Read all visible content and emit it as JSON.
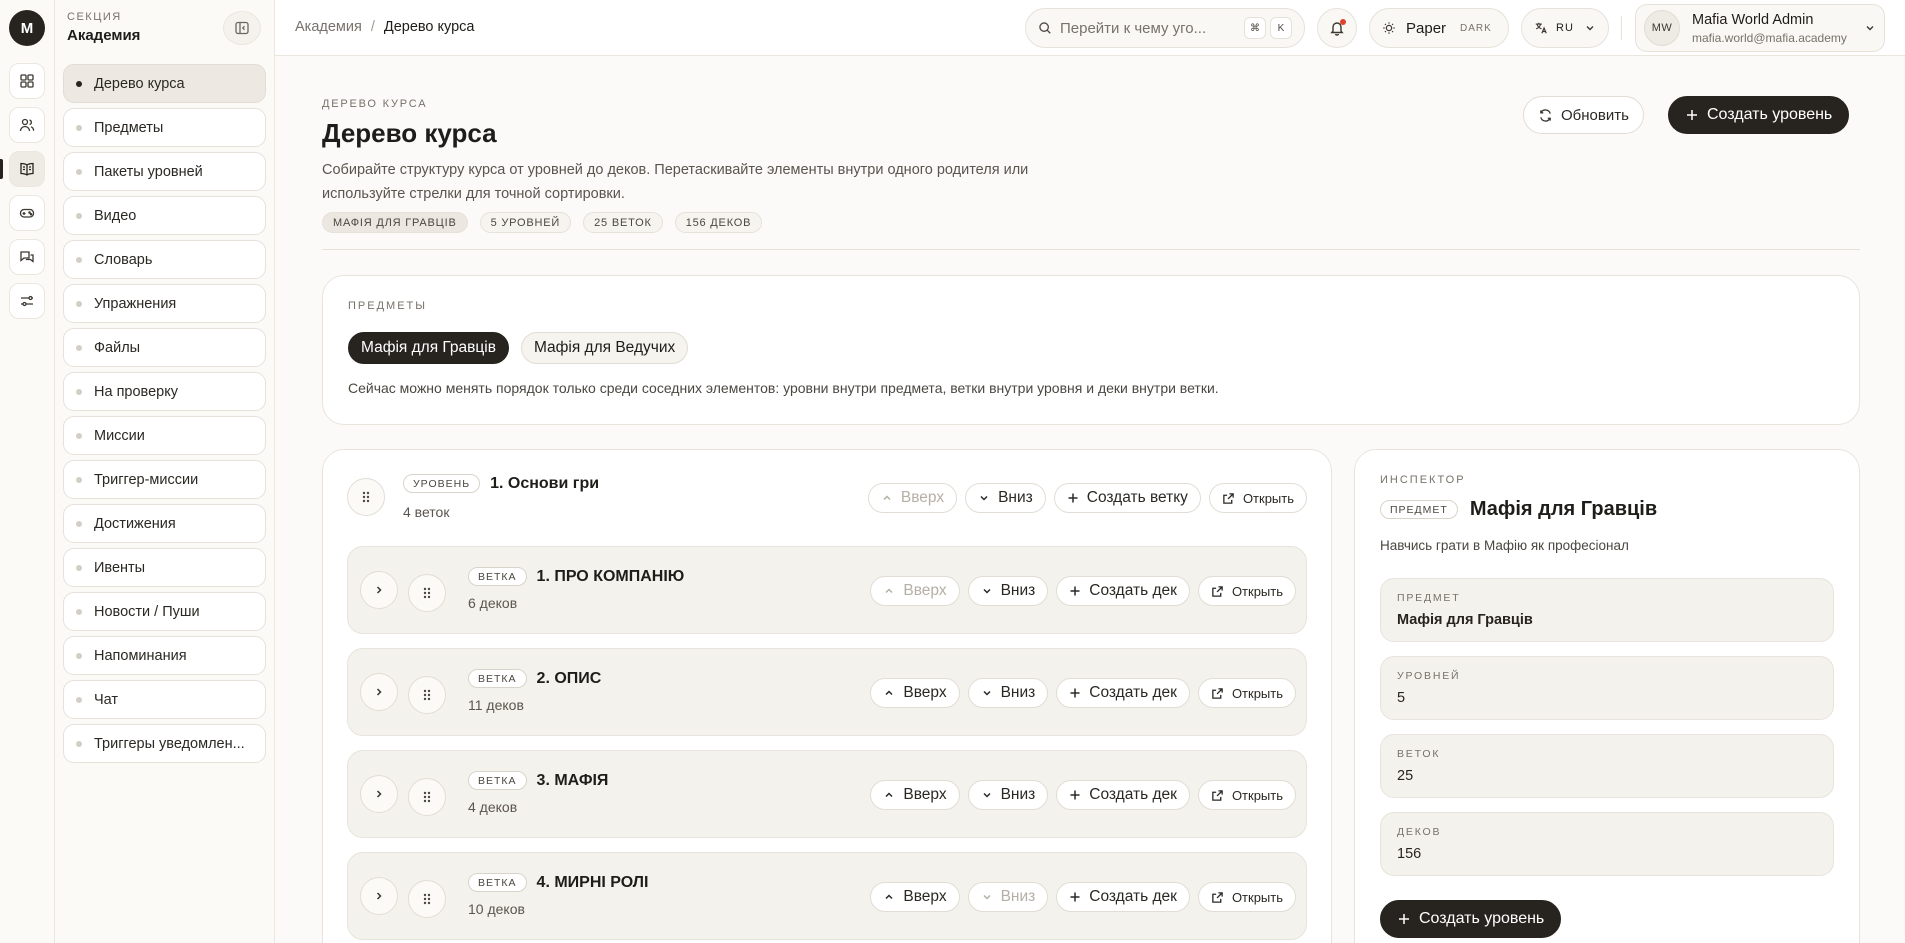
{
  "rail": {
    "logo": "M",
    "icons": [
      "grid-icon",
      "users-icon",
      "book-icon",
      "gamepad-icon",
      "chat-icon",
      "sliders-icon"
    ]
  },
  "sidebar": {
    "kicker": "СЕКЦИЯ",
    "title": "Академия",
    "items": [
      {
        "label": "Дерево курса",
        "active": true
      },
      {
        "label": "Предметы"
      },
      {
        "label": "Пакеты уровней"
      },
      {
        "label": "Видео"
      },
      {
        "label": "Словарь"
      },
      {
        "label": "Упражнения"
      },
      {
        "label": "Файлы"
      },
      {
        "label": "На проверку"
      },
      {
        "label": "Миссии"
      },
      {
        "label": "Триггер-миссии"
      },
      {
        "label": "Достижения"
      },
      {
        "label": "Ивенты"
      },
      {
        "label": "Новости / Пуши"
      },
      {
        "label": "Напоминания"
      },
      {
        "label": "Чат"
      },
      {
        "label": "Триггеры уведомлен..."
      }
    ]
  },
  "topbar": {
    "breadcrumb": {
      "root": "Академия",
      "separator": "/",
      "current": "Дерево курса"
    },
    "search": {
      "placeholder": "Перейти к чему уго...",
      "kbd1": "⌘",
      "kbd2": "K"
    },
    "theme": {
      "label": "Paper",
      "alt": "DARK"
    },
    "lang": "RU",
    "user": {
      "initials": "MW",
      "name": "Mafia World Admin",
      "email": "mafia.world@mafia.academy"
    }
  },
  "header": {
    "kicker": "ДЕРЕВО КУРСА",
    "title": "Дерево курса",
    "description": "Собирайте структуру курса от уровней до деков. Перетаскивайте элементы внутри одного родителя или используйте стрелки для точной сортировки.",
    "chips": [
      "МАФІЯ ДЛЯ ГРАВЦІВ",
      "5 УРОВНЕЙ",
      "25 ВЕТОК",
      "156 ДЕКОВ"
    ],
    "refresh_label": "Обновить",
    "create_level_label": "Создать уровень"
  },
  "subjects": {
    "label": "ПРЕДМЕТЫ",
    "tabs": [
      {
        "label": "Мафія для Гравців",
        "active": true
      },
      {
        "label": "Мафія для Ведучих"
      }
    ],
    "note": "Сейчас можно менять порядок только среди соседних элементов: уровни внутри предмета, ветки внутри уровня и деки внутри ветки."
  },
  "tree": {
    "level": {
      "tag": "УРОВЕНЬ",
      "title": "1. Основи гри",
      "sub": "4 веток",
      "up": "Вверх",
      "down": "Вниз",
      "create": "Создать ветку",
      "open": "Открыть"
    },
    "branches": [
      {
        "tag": "ВЕТКА",
        "title": "1. ПРО КОМПАНІЮ",
        "sub": "6 деков",
        "up": "Вверх",
        "down": "Вниз",
        "create": "Создать дек",
        "open": "Открыть",
        "up_disabled": true,
        "down_disabled": false
      },
      {
        "tag": "ВЕТКА",
        "title": "2. ОПИС",
        "sub": "11 деков",
        "up": "Вверх",
        "down": "Вниз",
        "create": "Создать дек",
        "open": "Открыть",
        "up_disabled": false,
        "down_disabled": false
      },
      {
        "tag": "ВЕТКА",
        "title": "3. МАФІЯ",
        "sub": "4 деков",
        "up": "Вверх",
        "down": "Вниз",
        "create": "Создать дек",
        "open": "Открыть",
        "up_disabled": false,
        "down_disabled": false
      },
      {
        "tag": "ВЕТКА",
        "title": "4. МИРНІ РОЛІ",
        "sub": "10 деков",
        "up": "Вверх",
        "down": "Вниз",
        "create": "Создать дек",
        "open": "Открыть",
        "up_disabled": false,
        "down_disabled": true
      }
    ]
  },
  "inspector": {
    "kicker": "ИНСПЕКТОР",
    "tag": "ПРЕДМЕТ",
    "title": "Мафія для Гравців",
    "description": "Навчись грати в Мафію як професіонал",
    "fields": [
      {
        "label": "ПРЕДМЕТ",
        "value": "Мафія для Гравців"
      },
      {
        "label": "УРОВНЕЙ",
        "value": "5"
      },
      {
        "label": "ВЕТОК",
        "value": "25"
      },
      {
        "label": "ДЕКОВ",
        "value": "156"
      }
    ],
    "create_level_label": "Создать уровень"
  }
}
